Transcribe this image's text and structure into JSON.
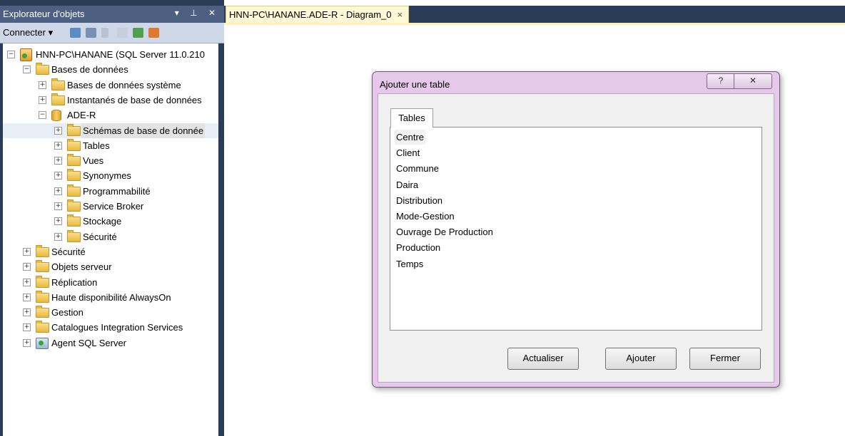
{
  "explorer": {
    "title": "Explorateur d'objets",
    "controls": "▾ ⊥ ✕",
    "connect_label": "Connecter ▾",
    "tree": {
      "server": "HNN-PC\\HANANE (SQL Server 11.0.210",
      "databases": "Bases de données",
      "system_dbs": "Bases de données système",
      "snapshots": "Instantanés de base de données",
      "db": "ADE-R",
      "db_children": [
        "Schémas de base de donnée",
        "Tables",
        "Vues",
        "Synonymes",
        "Programmabilité",
        "Service Broker",
        "Stockage",
        "Sécurité"
      ],
      "server_children": [
        "Sécurité",
        "Objets serveur",
        "Réplication",
        "Haute disponibilité AlwaysOn",
        "Gestion",
        "Catalogues Integration Services"
      ],
      "agent": "Agent SQL Server"
    }
  },
  "document_tab": {
    "label": "HNN-PC\\HANANE.ADE-R - Diagram_0",
    "close": "×"
  },
  "dialog": {
    "title": "Ajouter une table",
    "help": "?",
    "close": "✕",
    "tab": "Tables",
    "tables": [
      "Centre",
      "Client",
      "Commune",
      "Daira",
      "Distribution",
      "Mode-Gestion",
      "Ouvrage De Production",
      "Production",
      "Temps"
    ],
    "buttons": {
      "refresh": "Actualiser",
      "add": "Ajouter",
      "close": "Fermer"
    }
  },
  "colors": {
    "panel_dark": "#2b3c59",
    "tab_active": "#fff8d6",
    "dialog_frame": "#e6c8ea"
  }
}
